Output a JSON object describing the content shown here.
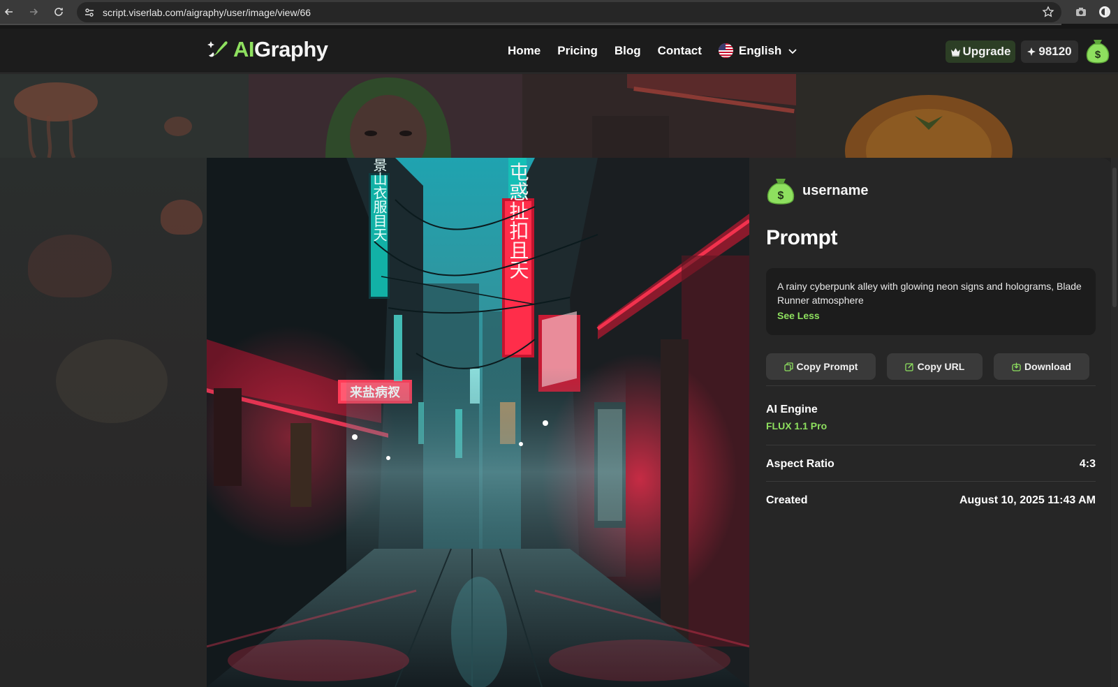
{
  "browser": {
    "url": "script.viserlab.com/aigraphy/user/image/view/66"
  },
  "header": {
    "logo_ai": "AI",
    "logo_rest": "Graphy",
    "nav": [
      {
        "label": "Home"
      },
      {
        "label": "Pricing"
      },
      {
        "label": "Blog"
      },
      {
        "label": "Contact"
      }
    ],
    "language": "English",
    "upgrade_label": "Upgrade",
    "credits": "98120"
  },
  "image_view": {
    "username": "username",
    "prompt_heading": "Prompt",
    "prompt_text": "A rainy cyberpunk alley with glowing neon signs and holograms, Blade Runner atmosphere",
    "see_less": "See Less",
    "actions": [
      {
        "label": "Copy Prompt",
        "icon": "copy-icon"
      },
      {
        "label": "Copy URL",
        "icon": "edit-link-icon"
      },
      {
        "label": "Download",
        "icon": "download-icon"
      }
    ],
    "ai_engine_label": "AI Engine",
    "ai_engine_value": "FLUX 1.1 Pro",
    "aspect_ratio_label": "Aspect Ratio",
    "aspect_ratio_value": "4:3",
    "created_label": "Created",
    "created_value": "August 10, 2025 11:43 AM"
  },
  "colors": {
    "accent": "#8ee05f",
    "header_bg": "#1c1c1c",
    "panel_bg": "#262626",
    "button_bg": "#3a3a3a"
  }
}
